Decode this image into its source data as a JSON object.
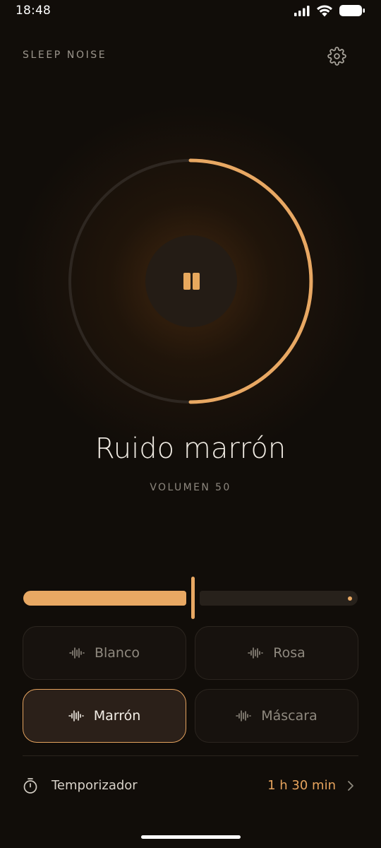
{
  "status_bar": {
    "time": "18:48",
    "icons": [
      "signal-icon",
      "wifi-icon",
      "battery-icon"
    ]
  },
  "header": {
    "app_title": "SLEEP NOISE",
    "settings_icon": "gear-icon"
  },
  "player": {
    "progress_fraction": 0.5,
    "state": "playing",
    "pause_icon": "pause-icon",
    "title": "Ruido marrón",
    "volume_label": "VOLUMEN 50"
  },
  "volume_slider": {
    "value": 50,
    "min": 0,
    "max": 100
  },
  "sound_types": [
    {
      "label": "Blanco",
      "icon": "waveform-icon",
      "active": false
    },
    {
      "label": "Rosa",
      "icon": "waveform-icon",
      "active": false
    },
    {
      "label": "Marrón",
      "icon": "waveform-icon",
      "active": true
    },
    {
      "label": "Máscara",
      "icon": "waveform-icon",
      "active": false
    }
  ],
  "timer": {
    "label": "Temporizador",
    "value": "1 h 30 min",
    "icon": "stopwatch-icon",
    "chevron": "chevron-right-icon"
  },
  "colors": {
    "accent": "#e8a863",
    "background": "#110d09",
    "track": "#27211b"
  }
}
